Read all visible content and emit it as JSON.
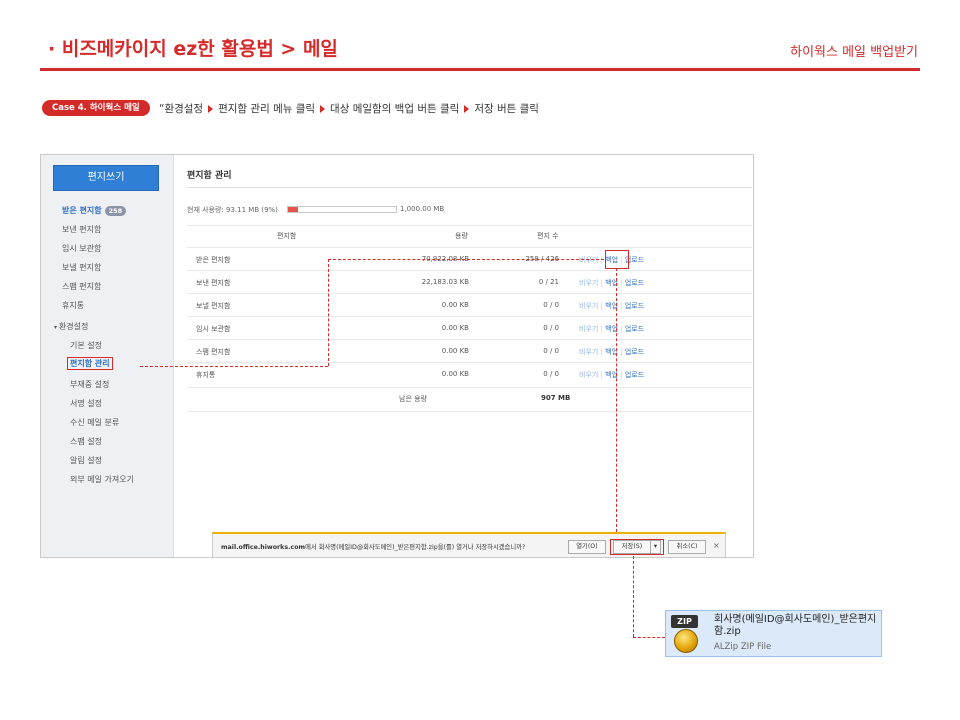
{
  "header": {
    "title": "· 비즈메카이지 ez한 활용법 > 메일",
    "subtitle": "하이웍스 메일 백업받기",
    "accent_color": "#d42a2a"
  },
  "case": {
    "badge": "Case 4. 하이웍스 메일",
    "steps": [
      "“환경설정",
      "편지함 관리 메뉴 클릭",
      "대상 메일함의 백업 버튼 클릭",
      "저장 버튼 클릭"
    ]
  },
  "sidebar": {
    "write_button": "편지쓰기",
    "inbox_label": "받은 편지함",
    "inbox_count": "258",
    "items": [
      "보낸 편지함",
      "임시 보관함",
      "보낼 편지함",
      "스팸 편지함",
      "휴지통"
    ],
    "settings_label": "환경설정",
    "settings_items": [
      "기본 설정",
      "편지함 관리",
      "부재중 설정",
      "서명 설정",
      "수신 메일 분류",
      "스팸 설정",
      "알림 설정",
      "외부 메일 가져오기"
    ]
  },
  "main": {
    "title": "편지함 관리",
    "usage_label": "현재 사용량: 93.11 MB (9%)",
    "usage_percent": 9,
    "usage_max": "1,000.00 MB",
    "columns": [
      "편지함",
      "용량",
      "편지 수"
    ],
    "rows": [
      {
        "name": "받은 편지함",
        "size": "70,922.08 KB",
        "count": "258 / 426"
      },
      {
        "name": "보낸 편지함",
        "size": "22,183.03 KB",
        "count": "0 / 21"
      },
      {
        "name": "보낼 편지함",
        "size": "0.00 KB",
        "count": "0 / 0"
      },
      {
        "name": "임시 보관함",
        "size": "0.00 KB",
        "count": "0 / 0"
      },
      {
        "name": "스팸 편지함",
        "size": "0.00 KB",
        "count": "0 / 0"
      },
      {
        "name": "휴지통",
        "size": "0.00 KB",
        "count": "0 / 0"
      }
    ],
    "actions": {
      "empty": "비우기",
      "backup": "백업",
      "upload": "업로드"
    },
    "remaining_label": "남은 용량",
    "remaining_value": "907 MB"
  },
  "download_bar": {
    "site": "mail.office.hiworks.com",
    "message": "에서 회사명(메일ID@회사도메인)_받은편지함.zip을(를) 열거나 저장하시겠습니까?",
    "open_label": "열기(O)",
    "save_label": "저장(S)",
    "cancel_label": "취소(C)",
    "close_glyph": "×"
  },
  "zip_file": {
    "badge": "ZIP",
    "name": "회사명(메일ID@회사도메인)_받은편지함.zip",
    "type": "ALZip ZIP File"
  }
}
